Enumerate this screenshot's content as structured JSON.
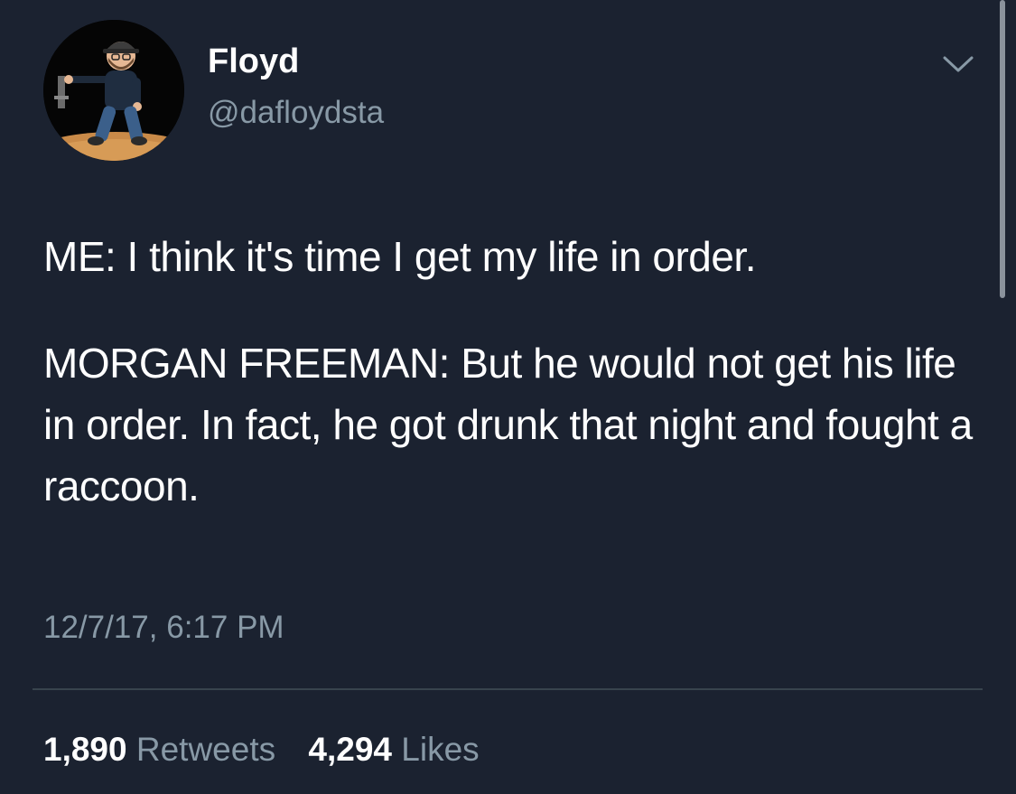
{
  "tweet": {
    "author": {
      "name": "Floyd",
      "handle": "@dafloydsta"
    },
    "text": {
      "line1": "ME: I think it's time I get my life in order.",
      "line2": "MORGAN FREEMAN: But he would not get his life in order. In fact, he got drunk that night and fought a raccoon."
    },
    "timestamp": "12/7/17, 6:17 PM",
    "stats": {
      "retweets_count": "1,890",
      "retweets_label": "Retweets",
      "likes_count": "4,294",
      "likes_label": "Likes"
    },
    "icons": {
      "menu": "chevron-down-icon",
      "avatar": "cartoon-avatar"
    }
  },
  "colors": {
    "background": "#1b2230",
    "text_primary": "#ffffff",
    "text_secondary": "#8899a6",
    "divider": "#38444d"
  }
}
